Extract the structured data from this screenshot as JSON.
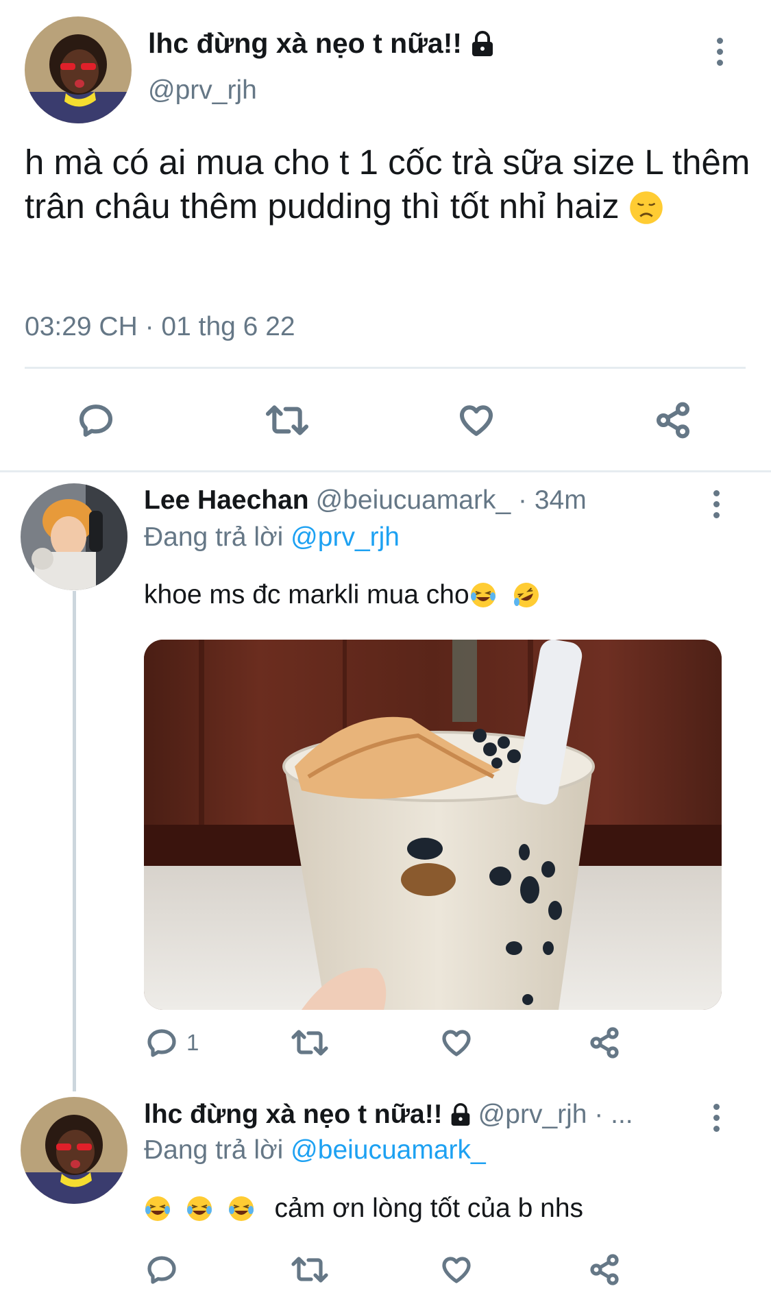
{
  "main_tweet": {
    "display_name": "lhc đừng xà nẹo t nữa!!",
    "handle": "@prv_rjh",
    "text": "h mà có ai mua cho t 1 cốc trà sữa size L thêm trân châu thêm pudding thì tốt nhỉ haiz",
    "timestamp": "03:29 CH · 01 thg 6 22"
  },
  "replies": [
    {
      "display_name": "Lee Haechan",
      "meta": "@beiucuamark_ · 34m",
      "replying_label": "Đang trả lời",
      "replying_to": "@prv_rjh",
      "text": "khoe ms đc markli mua cho",
      "reply_count": "1"
    },
    {
      "display_name": "lhc đừng xà nẹo t nữa!!",
      "meta": "@prv_rjh · ...",
      "replying_label": "Đang trả lời",
      "replying_to": "@beiucuamark_",
      "text": "cảm ơn lòng tốt của b nhs"
    }
  ],
  "icons": [
    "lock-icon",
    "more-icon",
    "reply-icon",
    "retweet-icon",
    "like-icon",
    "share-icon",
    "sad-face-emoji",
    "laughing-emoji",
    "rofl-emoji"
  ],
  "colors": {
    "link": "#1da1f2",
    "secondary": "#657786",
    "text": "#14171a",
    "divider": "#e6ecf0"
  }
}
